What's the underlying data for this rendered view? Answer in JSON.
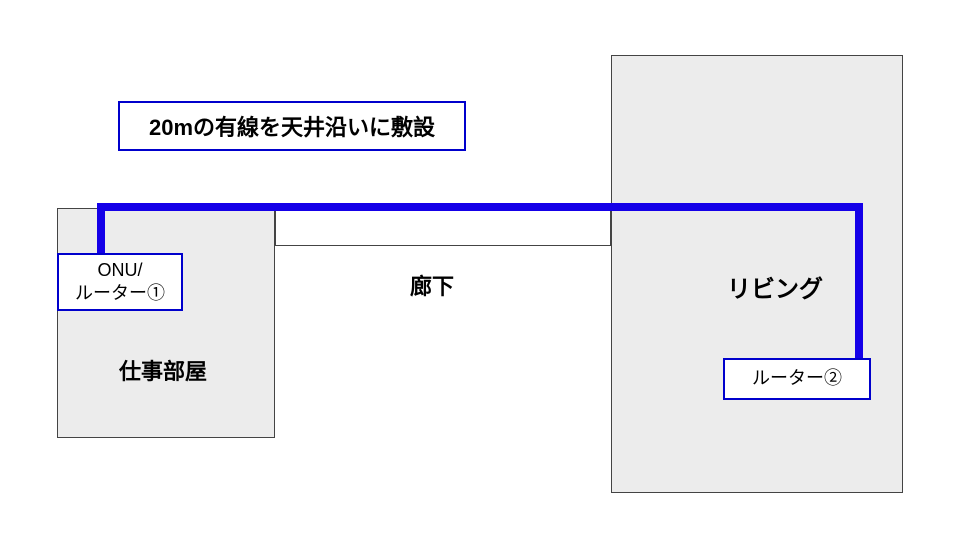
{
  "title": "20mの有線を天井沿いに敷設",
  "rooms": {
    "work_room": {
      "label": "仕事部屋"
    },
    "hallway": {
      "label": "廊下"
    },
    "living": {
      "label": "リビング"
    }
  },
  "devices": {
    "onu_router1": {
      "label": "ONU/\nルーター①"
    },
    "router2": {
      "label": "ルーター②"
    }
  },
  "cable": {
    "color": "#1500e8",
    "length_m": 20
  }
}
